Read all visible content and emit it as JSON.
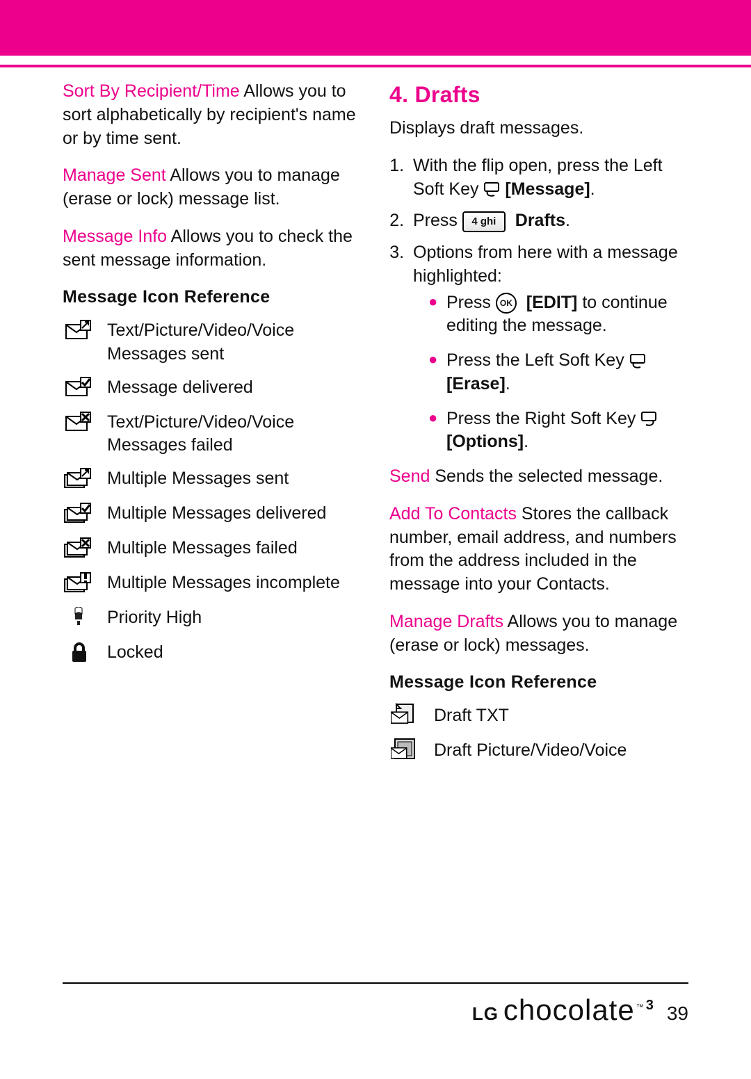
{
  "left": {
    "items": [
      {
        "term": "Sort By Recipient/Time",
        "rest": "  Allows you to sort alphabetically by recipient's name or by time sent."
      },
      {
        "term": "Manage Sent",
        "rest": "  Allows you to manage (erase or lock) message list."
      },
      {
        "term": "Message Info",
        "rest": "  Allows you to check the sent message information."
      }
    ],
    "iconref_title": "Message Icon Reference",
    "icons": [
      {
        "name": "envelope-send-icon",
        "label": "Text/Picture/Video/Voice Messages sent"
      },
      {
        "name": "envelope-check-icon",
        "label": "Message delivered"
      },
      {
        "name": "envelope-failed-icon",
        "label": "Text/Picture/Video/Voice Messages failed"
      },
      {
        "name": "multi-send-icon",
        "label": "Multiple Messages sent"
      },
      {
        "name": "multi-check-icon",
        "label": "Multiple Messages delivered"
      },
      {
        "name": "multi-failed-icon",
        "label": "Multiple Messages failed"
      },
      {
        "name": "multi-incomplete-icon",
        "label": "Multiple Messages incomplete"
      },
      {
        "name": "priority-high-icon",
        "label": "Priority High"
      },
      {
        "name": "locked-icon",
        "label": "Locked"
      }
    ]
  },
  "right": {
    "title": "4. Drafts",
    "intro": "Displays draft messages.",
    "step1_a": "With the flip open, press the Left Soft Key  ",
    "step1_b": "[Message]",
    "step1_c": ".",
    "step2_a": "Press  ",
    "step2_key": "4 ghi",
    "step2_b": "Drafts",
    "step2_c": ".",
    "step3": "Options from here with a message highlighted:",
    "bullets": [
      {
        "pre": "Press  ",
        "ok": "OK",
        "bold": "[EDIT]",
        "post": " to continue editing the message."
      },
      {
        "pre": "Press the Left Soft Key  ",
        "icon": "softkey-left",
        "bold": "[Erase]",
        "post": "."
      },
      {
        "pre": "Press the Right Soft Key  ",
        "icon": "softkey-right",
        "bold": "[Options]",
        "post": "."
      }
    ],
    "definitions": [
      {
        "term": "Send",
        "rest": "  Sends the selected message."
      },
      {
        "term": "Add To Contacts",
        "rest": "  Stores the callback number, email address, and numbers from the address included in the message into your Contacts."
      },
      {
        "term": "Manage Drafts",
        "rest": "  Allows you to manage (erase or lock) messages."
      }
    ],
    "iconref_title": "Message Icon Reference",
    "icons": [
      {
        "name": "draft-txt-icon",
        "label": "Draft TXT"
      },
      {
        "name": "draft-media-icon",
        "label": "Draft Picture/Video/Voice"
      }
    ]
  },
  "footer": {
    "brand_lg": "LG",
    "brand": "chocolate",
    "page": "39"
  }
}
